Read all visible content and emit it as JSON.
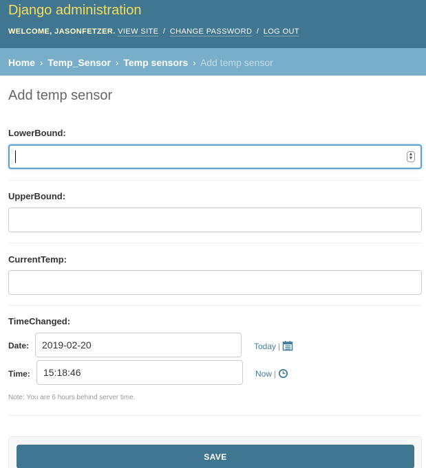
{
  "header": {
    "site_name": "Django administration",
    "welcome": "WELCOME,",
    "username": "JASONFETZER",
    "view_site": "VIEW SITE",
    "change_password": "CHANGE PASSWORD",
    "log_out": "LOG OUT",
    "separator": "/"
  },
  "breadcrumbs": {
    "items": [
      "Home",
      "Temp_Sensor",
      "Temp sensors"
    ],
    "current": "Add temp sensor",
    "separator": "›"
  },
  "page_title": "Add temp sensor",
  "form": {
    "lower_bound": {
      "label": "LowerBound:",
      "value": ""
    },
    "upper_bound": {
      "label": "UpperBound:",
      "value": ""
    },
    "current_temp": {
      "label": "CurrentTemp:",
      "value": ""
    },
    "time_changed": {
      "label": "TimeChanged:",
      "date_label": "Date:",
      "date_value": "2019-02-20",
      "today_link": "Today",
      "time_label": "Time:",
      "time_value": "15:18:46",
      "now_link": "Now",
      "shortcut_sep": "|",
      "note": "Note: You are 6 hours behind server time."
    }
  },
  "submit": {
    "save_label": "SAVE"
  },
  "icons": {
    "calendar": "calendar-icon",
    "clock": "clock-icon",
    "spinner": "number-spinner-icon"
  },
  "colors": {
    "header_bg": "#417690",
    "brand": "#f5dd5d",
    "breadcrumbs_bg": "#79aec8",
    "link": "#447e9b",
    "focus": "#5e9ed6"
  }
}
